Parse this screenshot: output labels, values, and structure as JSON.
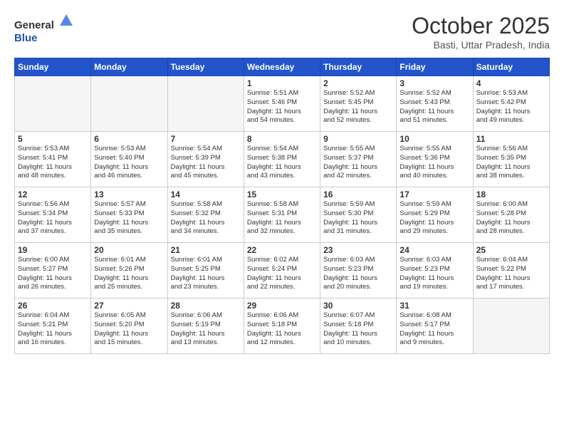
{
  "header": {
    "logo_general": "General",
    "logo_blue": "Blue",
    "month_title": "October 2025",
    "location": "Basti, Uttar Pradesh, India"
  },
  "days_of_week": [
    "Sunday",
    "Monday",
    "Tuesday",
    "Wednesday",
    "Thursday",
    "Friday",
    "Saturday"
  ],
  "weeks": [
    [
      {
        "num": "",
        "info": ""
      },
      {
        "num": "",
        "info": ""
      },
      {
        "num": "",
        "info": ""
      },
      {
        "num": "1",
        "info": "Sunrise: 5:51 AM\nSunset: 5:46 PM\nDaylight: 11 hours\nand 54 minutes."
      },
      {
        "num": "2",
        "info": "Sunrise: 5:52 AM\nSunset: 5:45 PM\nDaylight: 11 hours\nand 52 minutes."
      },
      {
        "num": "3",
        "info": "Sunrise: 5:52 AM\nSunset: 5:43 PM\nDaylight: 11 hours\nand 51 minutes."
      },
      {
        "num": "4",
        "info": "Sunrise: 5:53 AM\nSunset: 5:42 PM\nDaylight: 11 hours\nand 49 minutes."
      }
    ],
    [
      {
        "num": "5",
        "info": "Sunrise: 5:53 AM\nSunset: 5:41 PM\nDaylight: 11 hours\nand 48 minutes."
      },
      {
        "num": "6",
        "info": "Sunrise: 5:53 AM\nSunset: 5:40 PM\nDaylight: 11 hours\nand 46 minutes."
      },
      {
        "num": "7",
        "info": "Sunrise: 5:54 AM\nSunset: 5:39 PM\nDaylight: 11 hours\nand 45 minutes."
      },
      {
        "num": "8",
        "info": "Sunrise: 5:54 AM\nSunset: 5:38 PM\nDaylight: 11 hours\nand 43 minutes."
      },
      {
        "num": "9",
        "info": "Sunrise: 5:55 AM\nSunset: 5:37 PM\nDaylight: 11 hours\nand 42 minutes."
      },
      {
        "num": "10",
        "info": "Sunrise: 5:55 AM\nSunset: 5:36 PM\nDaylight: 11 hours\nand 40 minutes."
      },
      {
        "num": "11",
        "info": "Sunrise: 5:56 AM\nSunset: 5:35 PM\nDaylight: 11 hours\nand 38 minutes."
      }
    ],
    [
      {
        "num": "12",
        "info": "Sunrise: 5:56 AM\nSunset: 5:34 PM\nDaylight: 11 hours\nand 37 minutes."
      },
      {
        "num": "13",
        "info": "Sunrise: 5:57 AM\nSunset: 5:33 PM\nDaylight: 11 hours\nand 35 minutes."
      },
      {
        "num": "14",
        "info": "Sunrise: 5:58 AM\nSunset: 5:32 PM\nDaylight: 11 hours\nand 34 minutes."
      },
      {
        "num": "15",
        "info": "Sunrise: 5:58 AM\nSunset: 5:31 PM\nDaylight: 11 hours\nand 32 minutes."
      },
      {
        "num": "16",
        "info": "Sunrise: 5:59 AM\nSunset: 5:30 PM\nDaylight: 11 hours\nand 31 minutes."
      },
      {
        "num": "17",
        "info": "Sunrise: 5:59 AM\nSunset: 5:29 PM\nDaylight: 11 hours\nand 29 minutes."
      },
      {
        "num": "18",
        "info": "Sunrise: 6:00 AM\nSunset: 5:28 PM\nDaylight: 11 hours\nand 28 minutes."
      }
    ],
    [
      {
        "num": "19",
        "info": "Sunrise: 6:00 AM\nSunset: 5:27 PM\nDaylight: 11 hours\nand 26 minutes."
      },
      {
        "num": "20",
        "info": "Sunrise: 6:01 AM\nSunset: 5:26 PM\nDaylight: 11 hours\nand 25 minutes."
      },
      {
        "num": "21",
        "info": "Sunrise: 6:01 AM\nSunset: 5:25 PM\nDaylight: 11 hours\nand 23 minutes."
      },
      {
        "num": "22",
        "info": "Sunrise: 6:02 AM\nSunset: 5:24 PM\nDaylight: 11 hours\nand 22 minutes."
      },
      {
        "num": "23",
        "info": "Sunrise: 6:03 AM\nSunset: 5:23 PM\nDaylight: 11 hours\nand 20 minutes."
      },
      {
        "num": "24",
        "info": "Sunrise: 6:03 AM\nSunset: 5:23 PM\nDaylight: 11 hours\nand 19 minutes."
      },
      {
        "num": "25",
        "info": "Sunrise: 6:04 AM\nSunset: 5:22 PM\nDaylight: 11 hours\nand 17 minutes."
      }
    ],
    [
      {
        "num": "26",
        "info": "Sunrise: 6:04 AM\nSunset: 5:21 PM\nDaylight: 11 hours\nand 16 minutes."
      },
      {
        "num": "27",
        "info": "Sunrise: 6:05 AM\nSunset: 5:20 PM\nDaylight: 11 hours\nand 15 minutes."
      },
      {
        "num": "28",
        "info": "Sunrise: 6:06 AM\nSunset: 5:19 PM\nDaylight: 11 hours\nand 13 minutes."
      },
      {
        "num": "29",
        "info": "Sunrise: 6:06 AM\nSunset: 5:18 PM\nDaylight: 11 hours\nand 12 minutes."
      },
      {
        "num": "30",
        "info": "Sunrise: 6:07 AM\nSunset: 5:18 PM\nDaylight: 11 hours\nand 10 minutes."
      },
      {
        "num": "31",
        "info": "Sunrise: 6:08 AM\nSunset: 5:17 PM\nDaylight: 11 hours\nand 9 minutes."
      },
      {
        "num": "",
        "info": ""
      }
    ]
  ]
}
